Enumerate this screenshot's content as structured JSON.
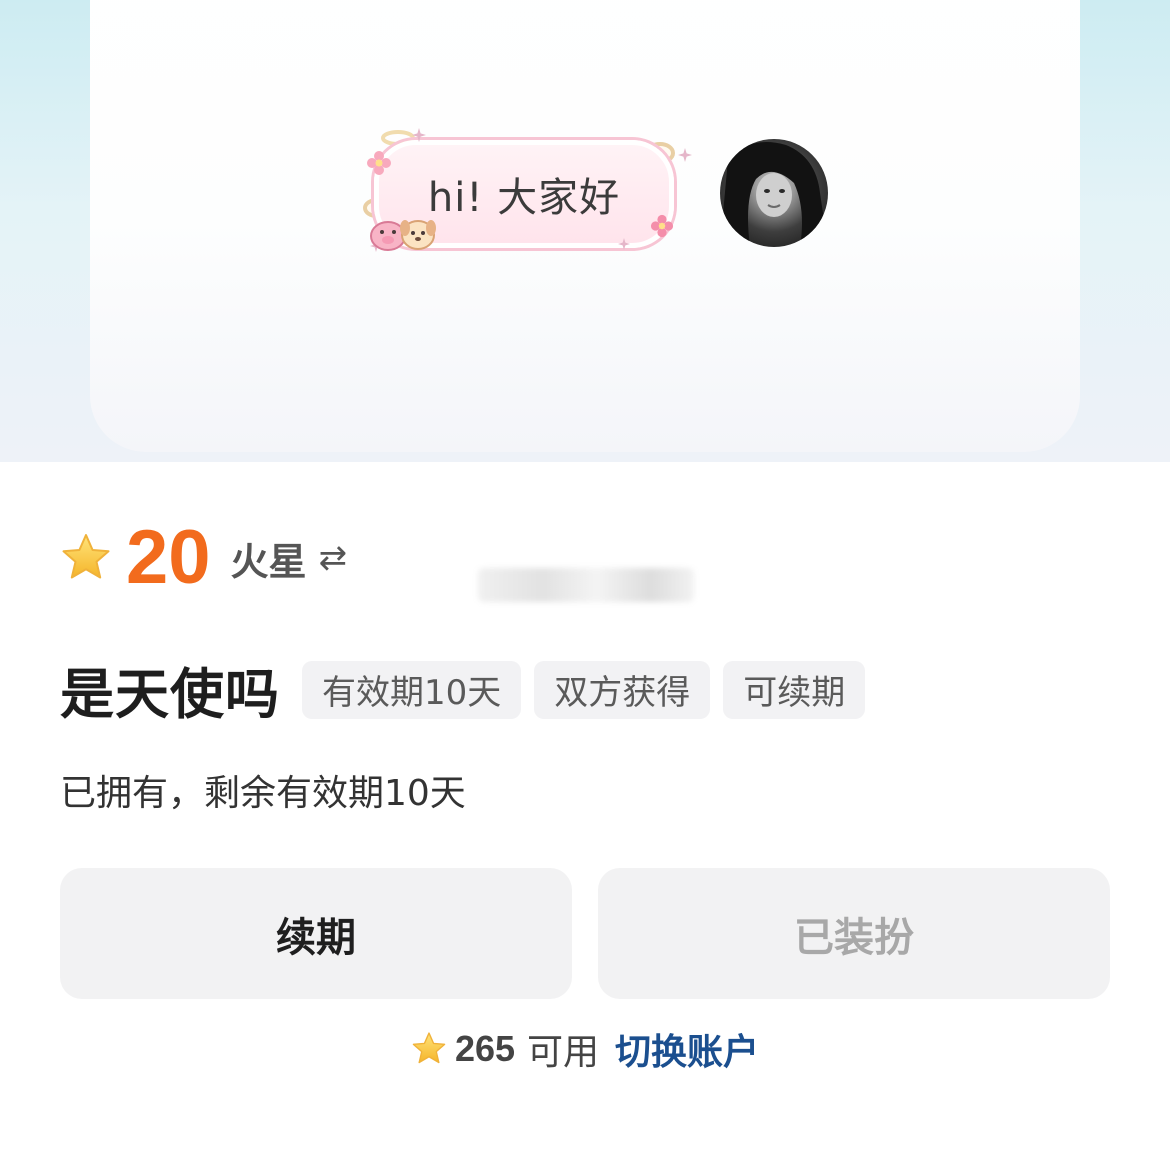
{
  "preview": {
    "bubble_text": "hi! 大家好"
  },
  "price": {
    "amount": "20",
    "unit": "火星",
    "swap_symbol": "⇄"
  },
  "item": {
    "title": "是天使吗",
    "tags": [
      "有效期10天",
      "双方获得",
      "可续期"
    ],
    "status": "已拥有，剩余有效期10天"
  },
  "actions": {
    "renew_label": "续期",
    "equipped_label": "已装扮"
  },
  "balance": {
    "amount": "265",
    "label": "可用",
    "switch_label": "切换账户"
  },
  "colors": {
    "accent_price": "#f26b1d",
    "link": "#1b4f8f",
    "star": "#f7c331"
  },
  "icons": {
    "price_star": "star-icon",
    "balance_star": "star-icon",
    "swap": "swap-icon"
  }
}
